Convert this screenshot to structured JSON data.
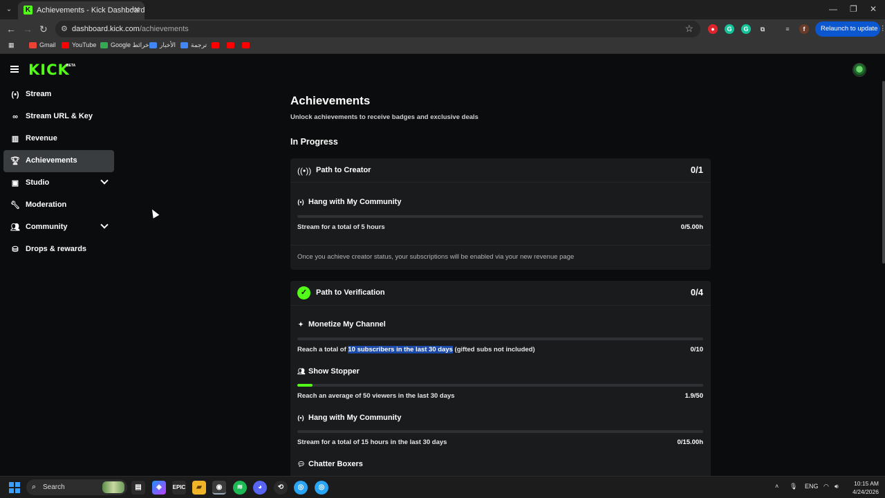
{
  "browser": {
    "tab_title": "Achievements - Kick Dashboard",
    "url_host": "dashboard.kick.com",
    "url_path": "/achievements",
    "relaunch_label": "Relaunch to update",
    "bookmarks": [
      "Gmail",
      "YouTube",
      "Google خرائط",
      "الأخبار",
      "ترجمة"
    ]
  },
  "sidebar": {
    "logo": "KICK",
    "logo_badge": "BETA",
    "items": [
      {
        "label": "Stream",
        "icon": "broadcast-icon"
      },
      {
        "label": "Stream URL & Key",
        "icon": "link-icon"
      },
      {
        "label": "Revenue",
        "icon": "chart-icon"
      },
      {
        "label": "Achievements",
        "icon": "trophy-icon",
        "active": true
      },
      {
        "label": "Studio",
        "icon": "studio-icon",
        "expandable": true
      },
      {
        "label": "Moderation",
        "icon": "wrench-icon"
      },
      {
        "label": "Community",
        "icon": "community-icon",
        "expandable": true
      },
      {
        "label": "Drops & rewards",
        "icon": "drops-icon"
      }
    ]
  },
  "main": {
    "title": "Achievements",
    "subtitle": "Unlock achievements to receive badges and exclusive deals",
    "section_title": "In Progress",
    "cards": [
      {
        "title": "Path to Creator",
        "count": "0/1",
        "achievements": [
          {
            "title": "Hang with My Community",
            "desc": "Stream for a total of 5 hours",
            "value": "0/5.00h",
            "progress": 0
          }
        ],
        "note": "Once you achieve creator status, your subscriptions will be enabled via your new revenue page"
      },
      {
        "title": "Path to Verification",
        "count": "0/4",
        "achievements": [
          {
            "title": "Monetize My Channel",
            "desc_before": "Reach a total of ",
            "desc_highlight": "10 subscribers in the last 30 days",
            "desc_after": " (gifted subs not included)",
            "value": "0/10",
            "progress": 0
          },
          {
            "title": "Show Stopper",
            "desc": "Reach an average of 50 viewers in the last 30 days",
            "value": "1.9/50",
            "progress": 0.038
          },
          {
            "title": "Hang with My Community",
            "desc": "Stream for a total of 15 hours in the last 30 days",
            "value": "0/15.00h",
            "progress": 0
          },
          {
            "title": "Chatter Boxers"
          }
        ]
      }
    ]
  },
  "taskbar": {
    "search_placeholder": "Search",
    "language": "ENG",
    "time": "10:15 AM",
    "date": "4/24/2026"
  },
  "colors": {
    "accent": "#53fc18",
    "background": "#0b0c0d",
    "card": "#191b1d",
    "highlight": "#1c4aa8"
  }
}
